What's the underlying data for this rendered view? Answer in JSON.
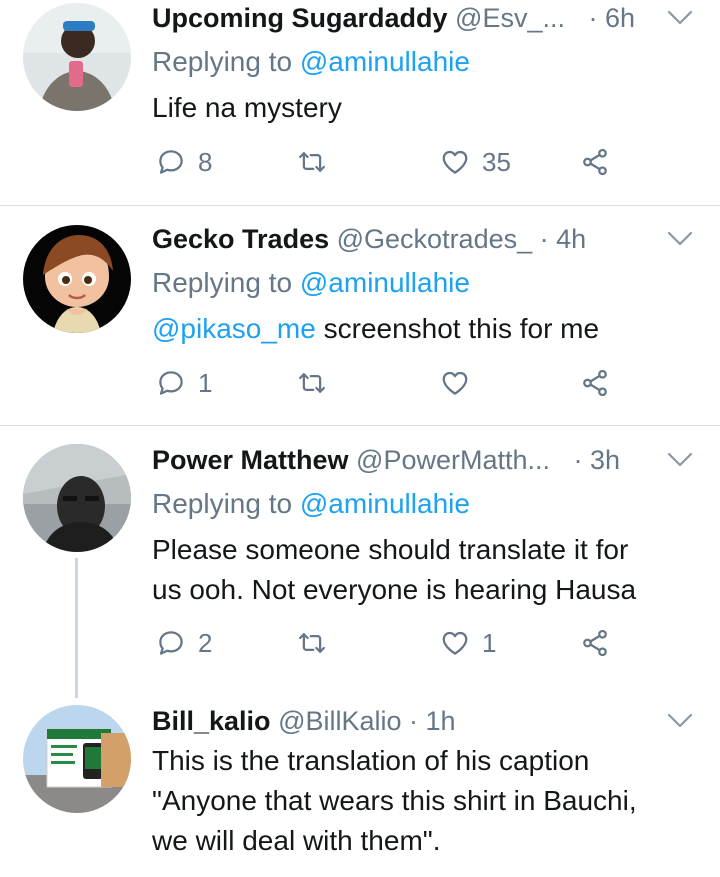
{
  "tweets": [
    {
      "name": "Upcoming Sugardaddy",
      "handle": "@Esv_...",
      "time": "· 6h",
      "replying_label": "Replying to",
      "replying_to": "@aminullahie",
      "text": "Life na mystery",
      "reply_count": "8",
      "retweet_count": "",
      "like_count": "35"
    },
    {
      "name": "Gecko Trades",
      "handle": "@Geckotrades_",
      "time": "· 4h",
      "replying_label": "Replying to",
      "replying_to": "@aminullahie",
      "text_mention": "@pikaso_me",
      "text": " screenshot this for me",
      "reply_count": "1",
      "retweet_count": "",
      "like_count": ""
    },
    {
      "name": "Power Matthew",
      "handle": "@PowerMatth...",
      "time": "· 3h",
      "replying_label": "Replying to",
      "replying_to": "@aminullahie",
      "text_line1": "Please someone should translate it for",
      "text_line2": "us ooh. Not everyone is hearing Hausa",
      "reply_count": "2",
      "retweet_count": "",
      "like_count": "1"
    },
    {
      "name": "Bill_kalio",
      "handle": "@BillKalio",
      "time": "· 1h",
      "text_line1": "This is the translation of his caption",
      "text_line2": "\"Anyone that wears this shirt in Bauchi,",
      "text_line3": "we will deal with them\"."
    }
  ],
  "icons": {
    "reply": "reply-icon",
    "retweet": "retweet-icon",
    "like": "heart-icon",
    "share": "share-icon",
    "more": "chevron-down-icon"
  },
  "colors": {
    "text": "#14171a",
    "secondary": "#657786",
    "link": "#1da1f2",
    "divider": "#d9dee2"
  }
}
